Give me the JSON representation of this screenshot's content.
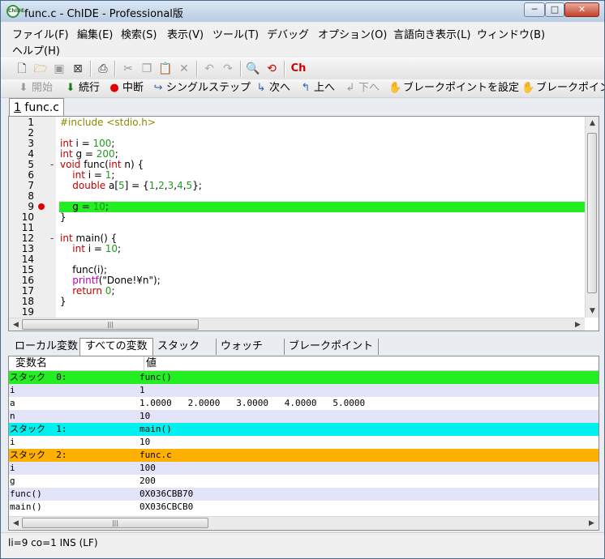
{
  "window": {
    "title": "func.c - ChIDE - Professional版",
    "icon_label": "ChIDE",
    "controls": {
      "minimize": "─",
      "maximize": "□",
      "close": "✕"
    }
  },
  "menu": [
    "ファイル(F)",
    "編集(E)",
    "検索(S)",
    "表示(V)",
    "ツール(T)",
    "デバッグ",
    "オプション(O)",
    "言語向き表示(L)",
    "ウィンドウ(B)",
    "ヘルプ(H)"
  ],
  "toolbar": {
    "ch_label": "Ch"
  },
  "debug_toolbar": [
    "開始",
    "続行",
    "中断",
    "シングルステップ",
    "次へ",
    "上へ",
    "下へ",
    "ブレークポイントを設定",
    "ブレークポイン"
  ],
  "file_tab": {
    "index": "1",
    "name": "func.c"
  },
  "editor": {
    "line_numbers": [
      "1",
      "2",
      "3",
      "4",
      "5",
      "6",
      "7",
      "8",
      "9",
      "10",
      "11",
      "12",
      "13",
      "14",
      "15",
      "16",
      "17",
      "18",
      "19"
    ],
    "fold_marks": {
      "5": "-",
      "12": "-"
    },
    "breakpoint_line": 9,
    "current_line": 9
  },
  "bottom_tabs": [
    "ローカル変数",
    "すべての変数",
    "スタック",
    "ウォッチ",
    "ブレークポイント"
  ],
  "bottom_tab_selected": "すべての変数",
  "variables": {
    "columns": [
      "変数名",
      "値"
    ],
    "rows": [
      {
        "name": "スタック  0:",
        "value": "func()",
        "color": "#22ee22"
      },
      {
        "name": "i",
        "value": "1",
        "color": "#e4e4f8"
      },
      {
        "name": "a",
        "value": "1.0000   2.0000   3.0000   4.0000   5.0000",
        "color": "#ffffff"
      },
      {
        "name": "n",
        "value": "10",
        "color": "#e4e4f8"
      },
      {
        "name": "スタック  1:",
        "value": "main()",
        "color": "#00f0f0"
      },
      {
        "name": "i",
        "value": "10",
        "color": "#ffffff"
      },
      {
        "name": "スタック  2:",
        "value": "func.c",
        "color": "#ffb000"
      },
      {
        "name": "i",
        "value": "100",
        "color": "#e4e4f8"
      },
      {
        "name": "g",
        "value": "200",
        "color": "#ffffff"
      },
      {
        "name": "func()",
        "value": "0X036CBB70",
        "color": "#e4e4f8"
      },
      {
        "name": "main()",
        "value": "0X036CBCB0",
        "color": "#ffffff"
      }
    ]
  },
  "status_bar": "li=9 co=1 INS (LF)",
  "colors": {
    "highlight": "#22ee22",
    "breakpoint": "#e00000"
  }
}
